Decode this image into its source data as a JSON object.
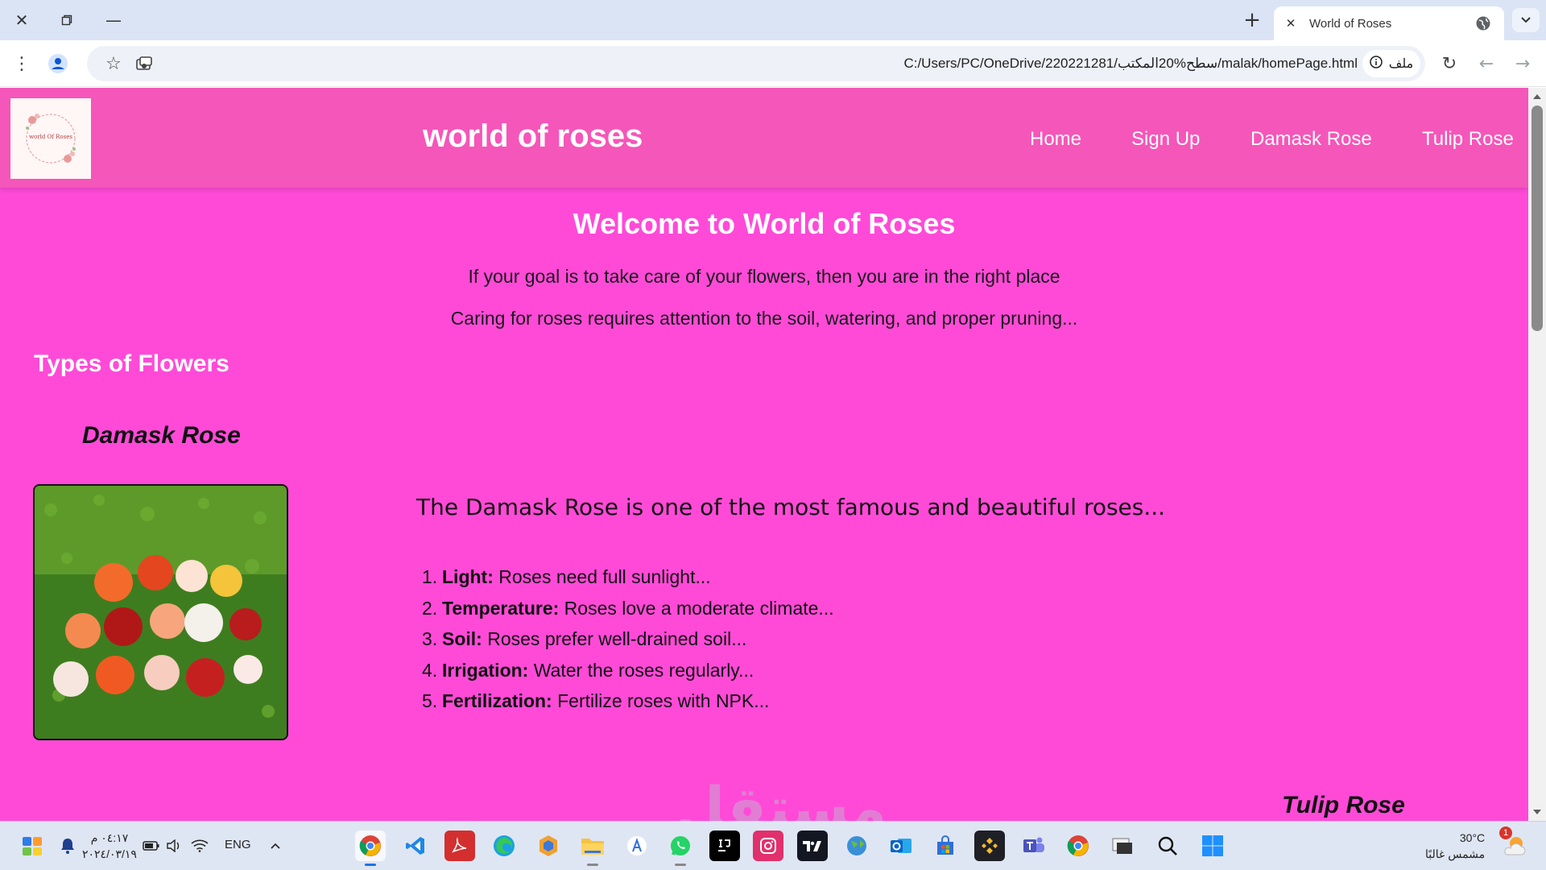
{
  "browser": {
    "tab_title": "World of Roses",
    "url": "C:/Users/PC/OneDrive/220221281/سطح%20المكتب/malak/homePage.html",
    "site_chip_label": "ملف"
  },
  "site": {
    "logo_text": "world Of Roses",
    "title": "world of roses",
    "nav": [
      "Home",
      "Sign Up",
      "Damask Rose",
      "Tulip Rose"
    ],
    "welcome_heading": "Welcome to World of Roses",
    "intro_lines": [
      "If your goal is to take care of your flowers, then you are in the right place",
      "Caring for roses requires attention to the soil, watering, and proper pruning..."
    ],
    "types_heading": "Types of Flowers",
    "damask": {
      "name": "Damask Rose",
      "description": "The Damask Rose is one of the most famous and beautiful roses...",
      "care": [
        {
          "num": "1.",
          "label": "Light:",
          "text": " Roses need full sunlight..."
        },
        {
          "num": "2.",
          "label": "Temperature:",
          "text": " Roses love a moderate climate..."
        },
        {
          "num": "3.",
          "label": "Soil:",
          "text": " Roses prefer well-drained soil..."
        },
        {
          "num": "4.",
          "label": "Irrigation:",
          "text": " Water the roses regularly..."
        },
        {
          "num": "5.",
          "label": "Fertilization:",
          "text": " Fertilize roses with NPK..."
        }
      ]
    },
    "tulip": {
      "name": "Tulip Rose"
    },
    "watermark": "مستقل"
  },
  "taskbar": {
    "time": "٠٤:١٧ م",
    "date": "٢٠٢٤/٠٣/١٩",
    "language": "ENG",
    "temperature": "30°C",
    "weather": "مشمس غالبًا",
    "weather_badge": "1",
    "apps": [
      "chrome",
      "vscode",
      "acrobat",
      "edge",
      "package",
      "file-explorer",
      "translate",
      "whatsapp",
      "intellij",
      "instagram",
      "tradingview",
      "globe",
      "outlook",
      "store",
      "binance",
      "teams",
      "chrome-2",
      "window",
      "search",
      "start"
    ]
  },
  "colors": {
    "page_bg": "#ff4ad8",
    "header_bg": "#f556b9",
    "chrome_bg": "#dbe4f5"
  }
}
